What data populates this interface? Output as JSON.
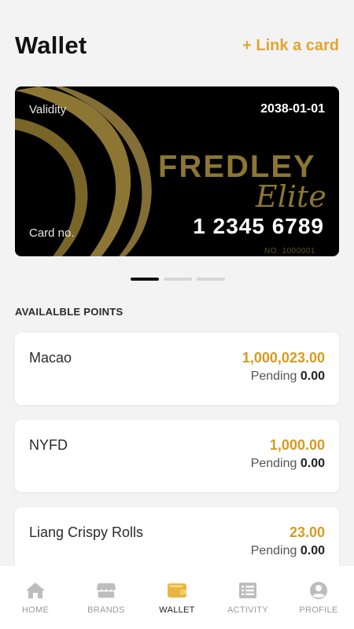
{
  "header": {
    "title": "Wallet",
    "link_card_label": "+ Link a card"
  },
  "card": {
    "validity_label": "Validity",
    "validity_value": "2038-01-01",
    "brand": "FREDLEY",
    "tier": "Elite",
    "card_no_label": "Card no.",
    "card_no_value": "1 2345 6789",
    "serial": "NO. 1000001"
  },
  "carousel": {
    "pages": 3,
    "active_index": 0
  },
  "points": {
    "section_label": "AVAILALBLE POINTS",
    "items": [
      {
        "name": "Macao",
        "value": "1,000,023.00",
        "pending_label": "Pending",
        "pending_value": "0.00"
      },
      {
        "name": "NYFD",
        "value": "1,000.00",
        "pending_label": "Pending",
        "pending_value": "0.00"
      },
      {
        "name": "Liang Crispy Rolls",
        "value": "23.00",
        "pending_label": "Pending",
        "pending_value": "0.00"
      }
    ]
  },
  "nav": {
    "items": [
      {
        "label": "HOME",
        "icon": "home-icon",
        "active": false
      },
      {
        "label": "BRANDS",
        "icon": "store-icon",
        "active": false
      },
      {
        "label": "WALLET",
        "icon": "wallet-icon",
        "active": true
      },
      {
        "label": "ACTIVITY",
        "icon": "list-icon",
        "active": false
      },
      {
        "label": "PROFILE",
        "icon": "profile-icon",
        "active": false
      }
    ]
  },
  "colors": {
    "accent": "#e1a62f",
    "points_value": "#d89a1e",
    "card_gold": "#8d7633",
    "nav_active_icon": "#e8b640",
    "nav_inactive_icon": "#bdbdbd"
  }
}
